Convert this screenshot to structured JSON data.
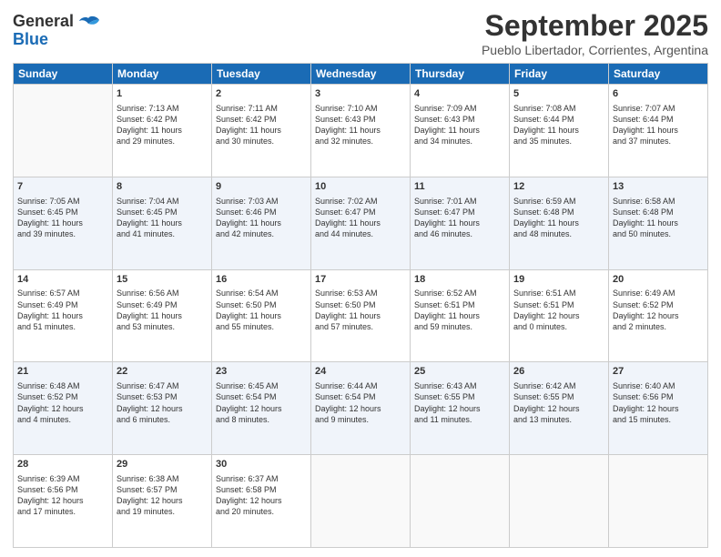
{
  "header": {
    "logo_general": "General",
    "logo_blue": "Blue",
    "month_title": "September 2025",
    "subtitle": "Pueblo Libertador, Corrientes, Argentina"
  },
  "days": [
    "Sunday",
    "Monday",
    "Tuesday",
    "Wednesday",
    "Thursday",
    "Friday",
    "Saturday"
  ],
  "weeks": [
    [
      {
        "day": "",
        "content": ""
      },
      {
        "day": "1",
        "content": "Sunrise: 7:13 AM\nSunset: 6:42 PM\nDaylight: 11 hours\nand 29 minutes."
      },
      {
        "day": "2",
        "content": "Sunrise: 7:11 AM\nSunset: 6:42 PM\nDaylight: 11 hours\nand 30 minutes."
      },
      {
        "day": "3",
        "content": "Sunrise: 7:10 AM\nSunset: 6:43 PM\nDaylight: 11 hours\nand 32 minutes."
      },
      {
        "day": "4",
        "content": "Sunrise: 7:09 AM\nSunset: 6:43 PM\nDaylight: 11 hours\nand 34 minutes."
      },
      {
        "day": "5",
        "content": "Sunrise: 7:08 AM\nSunset: 6:44 PM\nDaylight: 11 hours\nand 35 minutes."
      },
      {
        "day": "6",
        "content": "Sunrise: 7:07 AM\nSunset: 6:44 PM\nDaylight: 11 hours\nand 37 minutes."
      }
    ],
    [
      {
        "day": "7",
        "content": "Sunrise: 7:05 AM\nSunset: 6:45 PM\nDaylight: 11 hours\nand 39 minutes."
      },
      {
        "day": "8",
        "content": "Sunrise: 7:04 AM\nSunset: 6:45 PM\nDaylight: 11 hours\nand 41 minutes."
      },
      {
        "day": "9",
        "content": "Sunrise: 7:03 AM\nSunset: 6:46 PM\nDaylight: 11 hours\nand 42 minutes."
      },
      {
        "day": "10",
        "content": "Sunrise: 7:02 AM\nSunset: 6:47 PM\nDaylight: 11 hours\nand 44 minutes."
      },
      {
        "day": "11",
        "content": "Sunrise: 7:01 AM\nSunset: 6:47 PM\nDaylight: 11 hours\nand 46 minutes."
      },
      {
        "day": "12",
        "content": "Sunrise: 6:59 AM\nSunset: 6:48 PM\nDaylight: 11 hours\nand 48 minutes."
      },
      {
        "day": "13",
        "content": "Sunrise: 6:58 AM\nSunset: 6:48 PM\nDaylight: 11 hours\nand 50 minutes."
      }
    ],
    [
      {
        "day": "14",
        "content": "Sunrise: 6:57 AM\nSunset: 6:49 PM\nDaylight: 11 hours\nand 51 minutes."
      },
      {
        "day": "15",
        "content": "Sunrise: 6:56 AM\nSunset: 6:49 PM\nDaylight: 11 hours\nand 53 minutes."
      },
      {
        "day": "16",
        "content": "Sunrise: 6:54 AM\nSunset: 6:50 PM\nDaylight: 11 hours\nand 55 minutes."
      },
      {
        "day": "17",
        "content": "Sunrise: 6:53 AM\nSunset: 6:50 PM\nDaylight: 11 hours\nand 57 minutes."
      },
      {
        "day": "18",
        "content": "Sunrise: 6:52 AM\nSunset: 6:51 PM\nDaylight: 11 hours\nand 59 minutes."
      },
      {
        "day": "19",
        "content": "Sunrise: 6:51 AM\nSunset: 6:51 PM\nDaylight: 12 hours\nand 0 minutes."
      },
      {
        "day": "20",
        "content": "Sunrise: 6:49 AM\nSunset: 6:52 PM\nDaylight: 12 hours\nand 2 minutes."
      }
    ],
    [
      {
        "day": "21",
        "content": "Sunrise: 6:48 AM\nSunset: 6:52 PM\nDaylight: 12 hours\nand 4 minutes."
      },
      {
        "day": "22",
        "content": "Sunrise: 6:47 AM\nSunset: 6:53 PM\nDaylight: 12 hours\nand 6 minutes."
      },
      {
        "day": "23",
        "content": "Sunrise: 6:45 AM\nSunset: 6:54 PM\nDaylight: 12 hours\nand 8 minutes."
      },
      {
        "day": "24",
        "content": "Sunrise: 6:44 AM\nSunset: 6:54 PM\nDaylight: 12 hours\nand 9 minutes."
      },
      {
        "day": "25",
        "content": "Sunrise: 6:43 AM\nSunset: 6:55 PM\nDaylight: 12 hours\nand 11 minutes."
      },
      {
        "day": "26",
        "content": "Sunrise: 6:42 AM\nSunset: 6:55 PM\nDaylight: 12 hours\nand 13 minutes."
      },
      {
        "day": "27",
        "content": "Sunrise: 6:40 AM\nSunset: 6:56 PM\nDaylight: 12 hours\nand 15 minutes."
      }
    ],
    [
      {
        "day": "28",
        "content": "Sunrise: 6:39 AM\nSunset: 6:56 PM\nDaylight: 12 hours\nand 17 minutes."
      },
      {
        "day": "29",
        "content": "Sunrise: 6:38 AM\nSunset: 6:57 PM\nDaylight: 12 hours\nand 19 minutes."
      },
      {
        "day": "30",
        "content": "Sunrise: 6:37 AM\nSunset: 6:58 PM\nDaylight: 12 hours\nand 20 minutes."
      },
      {
        "day": "",
        "content": ""
      },
      {
        "day": "",
        "content": ""
      },
      {
        "day": "",
        "content": ""
      },
      {
        "day": "",
        "content": ""
      }
    ]
  ]
}
